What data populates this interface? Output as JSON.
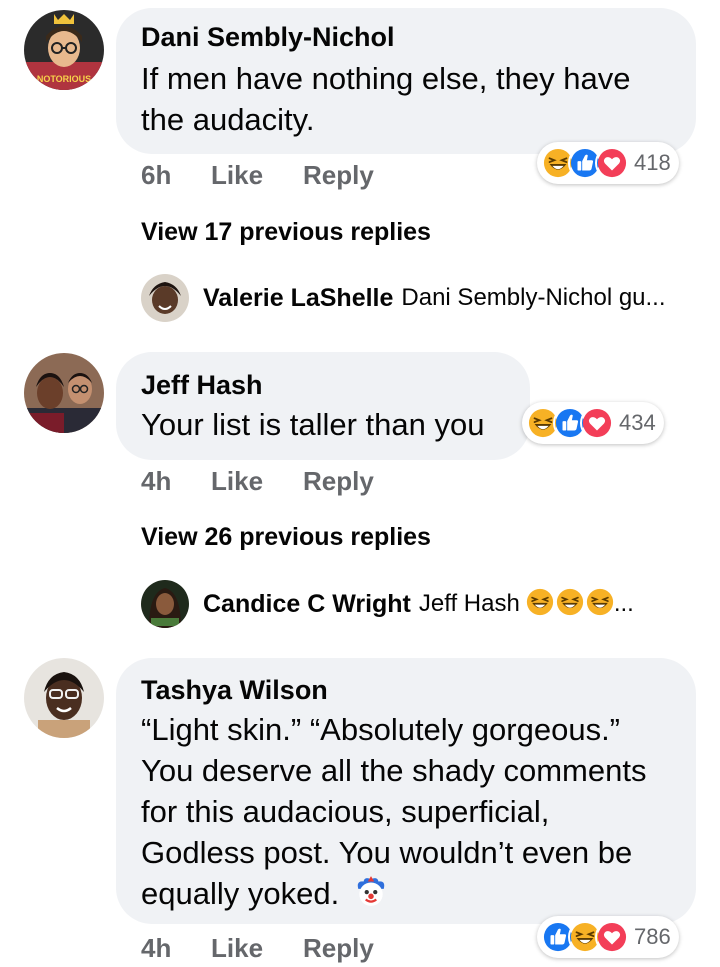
{
  "comments": [
    {
      "author": "Dani Sembly-Nichol",
      "avatar_caption": "NOTORIOUS",
      "lines": [
        "If men have nothing else, they have",
        "the audacity."
      ],
      "time": "6h",
      "like_label": "Like",
      "reply_label": "Reply",
      "reaction_icons": [
        "laugh-emoji",
        "like-emoji",
        "love-emoji"
      ],
      "reaction_count": "418",
      "view_previous": "View 17 previous replies",
      "latest_reply": {
        "name": "Valerie LaShelle",
        "text": "Dani Sembly-Nichol gu..."
      }
    },
    {
      "author": "Jeff Hash",
      "lines": [
        "Your list is taller than you"
      ],
      "time": "4h",
      "like_label": "Like",
      "reply_label": "Reply",
      "reaction_icons": [
        "laugh-emoji",
        "like-emoji",
        "love-emoji"
      ],
      "reaction_count": "434",
      "view_previous": "View 26 previous replies",
      "latest_reply": {
        "name": "Candice C Wright",
        "text": "Jeff Hash",
        "trailing": "..."
      }
    },
    {
      "author": "Tashya Wilson",
      "lines": [
        "“Light skin.” “Absolutely gorgeous.”",
        "You deserve all the shady comments",
        "for this audacious, superficial,",
        "Godless post. You wouldn’t even be",
        "equally yoked."
      ],
      "time": "4h",
      "like_label": "Like",
      "reply_label": "Reply",
      "reaction_icons": [
        "like-emoji",
        "laugh-emoji",
        "love-emoji"
      ],
      "reaction_count": "786"
    }
  ],
  "colors": {
    "bubble": "#f0f2f5",
    "meta": "#65676b",
    "like_blue": "#1877f2",
    "love_red": "#f33e58",
    "laugh_yellow": "#f7b125"
  }
}
